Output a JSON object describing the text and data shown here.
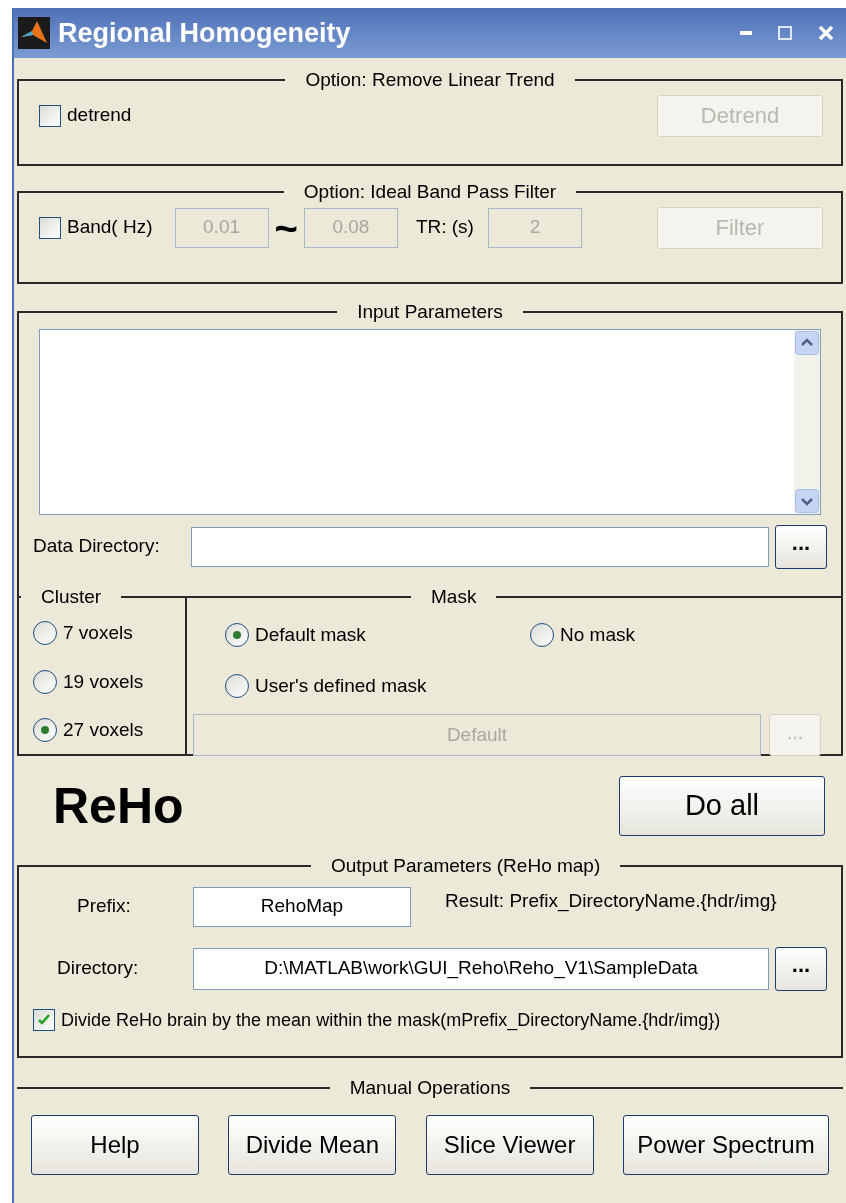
{
  "window": {
    "title": "Regional Homogeneity"
  },
  "detrend_panel": {
    "title": "Option: Remove Linear Trend",
    "checkbox": {
      "label": "detrend",
      "checked": false
    },
    "button": {
      "label": "Detrend",
      "disabled": true
    }
  },
  "filter_panel": {
    "title": "Option: Ideal Band Pass Filter",
    "checkbox": {
      "label": "Band( Hz)",
      "checked": false
    },
    "low": {
      "value": "0.01",
      "disabled": true
    },
    "separator": "~",
    "high": {
      "value": "0.08",
      "disabled": true
    },
    "tr_label": "TR: (s)",
    "tr": {
      "value": "2",
      "disabled": true
    },
    "button": {
      "label": "Filter",
      "disabled": true
    }
  },
  "input_panel": {
    "title": "Input Parameters",
    "data_directory": {
      "label": "Data Directory:",
      "browse": "..."
    },
    "cluster": {
      "title": "Cluster",
      "options": [
        {
          "label": "7 voxels",
          "selected": false
        },
        {
          "label": "19 voxels",
          "selected": false
        },
        {
          "label": "27 voxels",
          "selected": true
        }
      ]
    },
    "mask": {
      "title": "Mask",
      "options": [
        {
          "label": "Default mask",
          "selected": true
        },
        {
          "label": "No mask",
          "selected": false
        },
        {
          "label": "User's defined mask",
          "selected": false
        }
      ],
      "mask_file": {
        "value": "Default",
        "disabled": true
      },
      "browse": {
        "label": "...",
        "disabled": true
      }
    }
  },
  "reho_label": "ReHo",
  "do_all_button": "Do all",
  "output_panel": {
    "title": "Output Parameters (ReHo map)",
    "prefix_label": "Prefix:",
    "prefix": "RehoMap",
    "result_note": "Result: Prefix_DirectoryName.{hdr/img}",
    "directory_label": "Directory:",
    "directory": "D:\\MATLAB\\work\\GUI_Reho\\Reho_V1\\SampleData",
    "browse": "...",
    "divide": {
      "label": "Divide ReHo brain by the mean within the mask(mPrefix_DirectoryName.{hdr/img})",
      "checked": true
    }
  },
  "manual_panel": {
    "title": "Manual Operations",
    "buttons": [
      "Help",
      "Divide Mean",
      "Slice Viewer",
      "Power Spectrum"
    ]
  }
}
